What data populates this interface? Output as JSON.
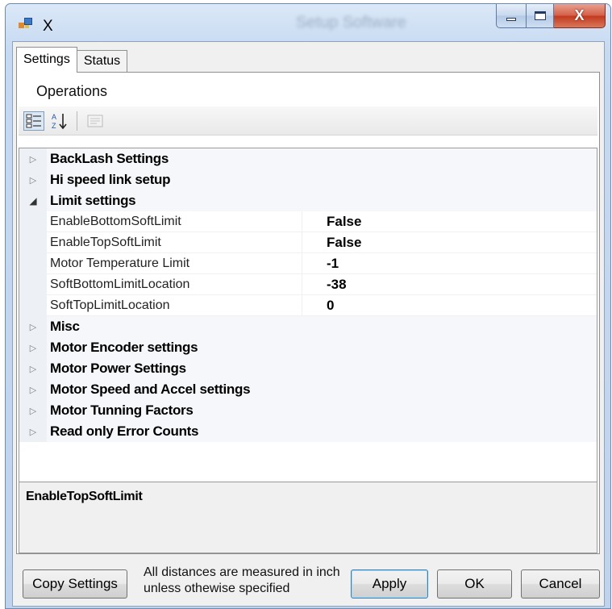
{
  "window": {
    "title": "X",
    "blurred_title": "Setup Software",
    "controls": {
      "minimize": "–",
      "maximize": "□",
      "close": "X"
    }
  },
  "tabs": [
    {
      "label": "Settings",
      "active": true
    },
    {
      "label": "Status",
      "active": false
    }
  ],
  "panel": {
    "header": "Operations"
  },
  "toolbar": {
    "categorized_icon": "categorized-icon",
    "alphabetical_icon": "alphabetical-sort-icon",
    "alphabetical_glyph": "A Z",
    "property_pages_icon": "property-pages-icon"
  },
  "property_grid": {
    "categories": [
      {
        "label": "BackLash Settings",
        "expanded": false
      },
      {
        "label": "Hi speed link setup",
        "expanded": false
      },
      {
        "label": "Limit settings",
        "expanded": true,
        "properties": [
          {
            "name": "EnableBottomSoftLimit",
            "value": "False"
          },
          {
            "name": "EnableTopSoftLimit",
            "value": "False"
          },
          {
            "name": "Motor Temperature Limit",
            "value": "-1"
          },
          {
            "name": "SoftBottomLimitLocation",
            "value": "-38"
          },
          {
            "name": "SoftTopLimitLocation",
            "value": "0"
          }
        ]
      },
      {
        "label": "Misc",
        "expanded": false
      },
      {
        "label": "Motor Encoder settings",
        "expanded": false
      },
      {
        "label": "Motor Power Settings",
        "expanded": false
      },
      {
        "label": "Motor Speed and Accel settings",
        "expanded": false
      },
      {
        "label": "Motor Tunning Factors",
        "expanded": false
      },
      {
        "label": "Read only Error Counts",
        "expanded": false
      }
    ]
  },
  "description": {
    "title": "EnableTopSoftLimit"
  },
  "footer": {
    "copy_settings": "Copy Settings",
    "note": "All distances are measured in inch unless othewise specified",
    "apply": "Apply",
    "ok": "OK",
    "cancel": "Cancel"
  },
  "colors": {
    "frame": "#c5d9f1",
    "close_button": "#c23a1f",
    "default_button_border": "#3c7fb1"
  }
}
